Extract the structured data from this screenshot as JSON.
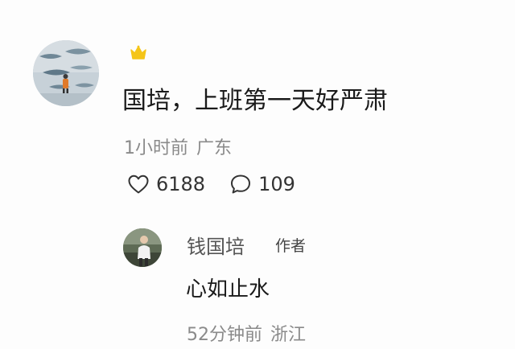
{
  "comment": {
    "text": "国培，上班第一天好严肃",
    "time": "1小时前",
    "location": "广东",
    "likes": "6188",
    "replies": "109",
    "badge_icon": "crown-icon",
    "colors": {
      "badge": "#f5c518",
      "text": "#1a1a1a",
      "meta": "#8a8a8a"
    }
  },
  "reply": {
    "author": "钱国培",
    "author_tag": "作者",
    "text": "心如止水",
    "time": "52分钟前",
    "location": "浙江"
  }
}
